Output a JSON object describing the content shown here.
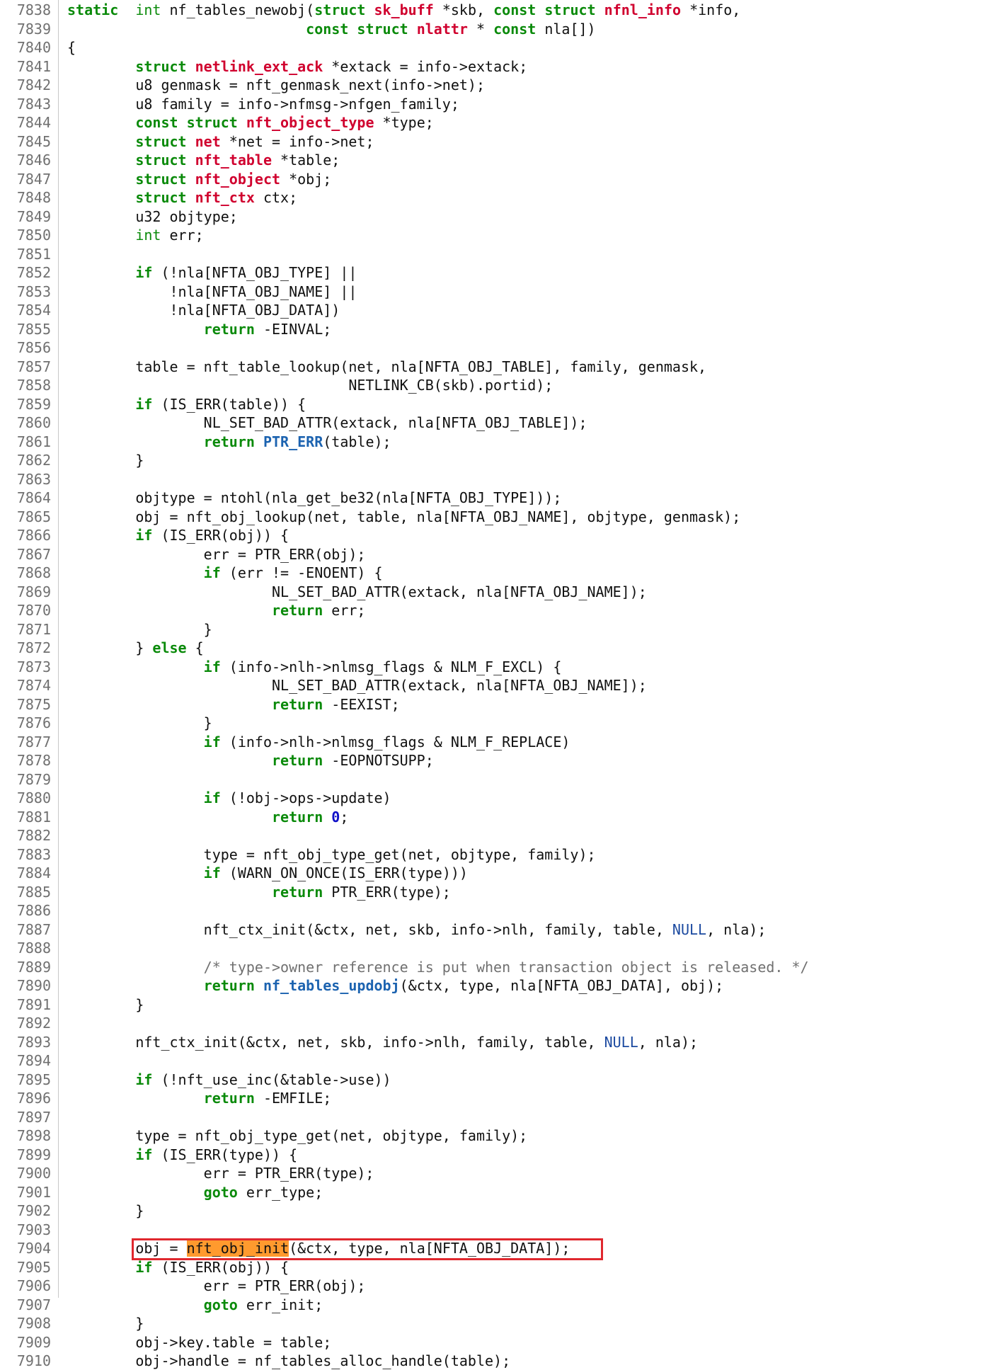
{
  "colors": {
    "keyword": "#0a8a0a",
    "struct_name": "#d0002e",
    "function_link": "#1c63b0",
    "number": "#1010c8",
    "constant": "#1c4aa0",
    "comment": "#707070",
    "line_number": "#707070",
    "highlight": "#ff9a2e",
    "annotation_box": "#e0282e"
  },
  "annotation": {
    "line_number": "7904",
    "highlighted_token": "nft_obj_init"
  },
  "lines": [
    {
      "n": "7838",
      "t": [
        [
          "kw",
          "static"
        ],
        [
          "",
          "  "
        ],
        [
          "ty",
          "int"
        ],
        [
          "",
          " nf_tables_newobj("
        ],
        [
          "kw",
          "struct"
        ],
        [
          "",
          " "
        ],
        [
          "st",
          "sk_buff"
        ],
        [
          "",
          " *skb, "
        ],
        [
          "kw",
          "const"
        ],
        [
          "",
          " "
        ],
        [
          "kw",
          "struct"
        ],
        [
          "",
          " "
        ],
        [
          "st",
          "nfnl_info"
        ],
        [
          "",
          " *info,"
        ]
      ]
    },
    {
      "n": "7839",
      "t": [
        [
          "",
          "                            "
        ],
        [
          "kw",
          "const"
        ],
        [
          "",
          " "
        ],
        [
          "kw",
          "struct"
        ],
        [
          "",
          " "
        ],
        [
          "st",
          "nlattr"
        ],
        [
          "",
          " * "
        ],
        [
          "kw",
          "const"
        ],
        [
          "",
          " nla[])"
        ]
      ]
    },
    {
      "n": "7840",
      "t": [
        [
          "",
          "{"
        ]
      ]
    },
    {
      "n": "7841",
      "t": [
        [
          "",
          "        "
        ],
        [
          "kw",
          "struct"
        ],
        [
          "",
          " "
        ],
        [
          "st",
          "netlink_ext_ack"
        ],
        [
          "",
          " *extack = info->extack;"
        ]
      ]
    },
    {
      "n": "7842",
      "t": [
        [
          "",
          "        u8 genmask = nft_genmask_next(info->net);"
        ]
      ]
    },
    {
      "n": "7843",
      "t": [
        [
          "",
          "        u8 family = info->nfmsg->nfgen_family;"
        ]
      ]
    },
    {
      "n": "7844",
      "t": [
        [
          "",
          "        "
        ],
        [
          "kw",
          "const"
        ],
        [
          "",
          " "
        ],
        [
          "kw",
          "struct"
        ],
        [
          "",
          " "
        ],
        [
          "st",
          "nft_object_type"
        ],
        [
          "",
          " *type;"
        ]
      ]
    },
    {
      "n": "7845",
      "t": [
        [
          "",
          "        "
        ],
        [
          "kw",
          "struct"
        ],
        [
          "",
          " "
        ],
        [
          "st",
          "net"
        ],
        [
          "",
          " *net = info->net;"
        ]
      ]
    },
    {
      "n": "7846",
      "t": [
        [
          "",
          "        "
        ],
        [
          "kw",
          "struct"
        ],
        [
          "",
          " "
        ],
        [
          "st",
          "nft_table"
        ],
        [
          "",
          " *table;"
        ]
      ]
    },
    {
      "n": "7847",
      "t": [
        [
          "",
          "        "
        ],
        [
          "kw",
          "struct"
        ],
        [
          "",
          " "
        ],
        [
          "st",
          "nft_object"
        ],
        [
          "",
          " *obj;"
        ]
      ]
    },
    {
      "n": "7848",
      "t": [
        [
          "",
          "        "
        ],
        [
          "kw",
          "struct"
        ],
        [
          "",
          " "
        ],
        [
          "st",
          "nft_ctx"
        ],
        [
          "",
          " ctx;"
        ]
      ]
    },
    {
      "n": "7849",
      "t": [
        [
          "",
          "        u32 objtype;"
        ]
      ]
    },
    {
      "n": "7850",
      "t": [
        [
          "",
          "        "
        ],
        [
          "ty",
          "int"
        ],
        [
          "",
          " err;"
        ]
      ]
    },
    {
      "n": "7851",
      "t": []
    },
    {
      "n": "7852",
      "t": [
        [
          "",
          "        "
        ],
        [
          "kw",
          "if"
        ],
        [
          "",
          " (!nla[NFTA_OBJ_TYPE] ||"
        ]
      ]
    },
    {
      "n": "7853",
      "t": [
        [
          "",
          "            !nla[NFTA_OBJ_NAME] ||"
        ]
      ]
    },
    {
      "n": "7854",
      "t": [
        [
          "",
          "            !nla[NFTA_OBJ_DATA])"
        ]
      ]
    },
    {
      "n": "7855",
      "t": [
        [
          "",
          "                "
        ],
        [
          "kw",
          "return"
        ],
        [
          "",
          " -EINVAL;"
        ]
      ]
    },
    {
      "n": "7856",
      "t": []
    },
    {
      "n": "7857",
      "t": [
        [
          "",
          "        table = nft_table_lookup(net, nla[NFTA_OBJ_TABLE], family, genmask,"
        ]
      ]
    },
    {
      "n": "7858",
      "t": [
        [
          "",
          "                                 NETLINK_CB(skb).portid);"
        ]
      ]
    },
    {
      "n": "7859",
      "t": [
        [
          "",
          "        "
        ],
        [
          "kw",
          "if"
        ],
        [
          "",
          " (IS_ERR(table)) {"
        ]
      ]
    },
    {
      "n": "7860",
      "t": [
        [
          "",
          "                NL_SET_BAD_ATTR(extack, nla[NFTA_OBJ_TABLE]);"
        ]
      ]
    },
    {
      "n": "7861",
      "t": [
        [
          "",
          "                "
        ],
        [
          "kw",
          "return"
        ],
        [
          "",
          " "
        ],
        [
          "fn",
          "PTR_ERR"
        ],
        [
          "",
          "(table);"
        ]
      ]
    },
    {
      "n": "7862",
      "t": [
        [
          "",
          "        }"
        ]
      ]
    },
    {
      "n": "7863",
      "t": []
    },
    {
      "n": "7864",
      "t": [
        [
          "",
          "        objtype = ntohl(nla_get_be32(nla[NFTA_OBJ_TYPE]));"
        ]
      ]
    },
    {
      "n": "7865",
      "t": [
        [
          "",
          "        obj = nft_obj_lookup(net, table, nla[NFTA_OBJ_NAME], objtype, genmask);"
        ]
      ]
    },
    {
      "n": "7866",
      "t": [
        [
          "",
          "        "
        ],
        [
          "kw",
          "if"
        ],
        [
          "",
          " (IS_ERR(obj)) {"
        ]
      ]
    },
    {
      "n": "7867",
      "t": [
        [
          "",
          "                err = PTR_ERR(obj);"
        ]
      ]
    },
    {
      "n": "7868",
      "t": [
        [
          "",
          "                "
        ],
        [
          "kw",
          "if"
        ],
        [
          "",
          " (err != -ENOENT) {"
        ]
      ]
    },
    {
      "n": "7869",
      "t": [
        [
          "",
          "                        NL_SET_BAD_ATTR(extack, nla[NFTA_OBJ_NAME]);"
        ]
      ]
    },
    {
      "n": "7870",
      "t": [
        [
          "",
          "                        "
        ],
        [
          "kw",
          "return"
        ],
        [
          "",
          " err;"
        ]
      ]
    },
    {
      "n": "7871",
      "t": [
        [
          "",
          "                }"
        ]
      ]
    },
    {
      "n": "7872",
      "t": [
        [
          "",
          "        } "
        ],
        [
          "kw",
          "else"
        ],
        [
          "",
          " {"
        ]
      ]
    },
    {
      "n": "7873",
      "t": [
        [
          "",
          "                "
        ],
        [
          "kw",
          "if"
        ],
        [
          "",
          " (info->nlh->nlmsg_flags & NLM_F_EXCL) {"
        ]
      ]
    },
    {
      "n": "7874",
      "t": [
        [
          "",
          "                        NL_SET_BAD_ATTR(extack, nla[NFTA_OBJ_NAME]);"
        ]
      ]
    },
    {
      "n": "7875",
      "t": [
        [
          "",
          "                        "
        ],
        [
          "kw",
          "return"
        ],
        [
          "",
          " -EEXIST;"
        ]
      ]
    },
    {
      "n": "7876",
      "t": [
        [
          "",
          "                }"
        ]
      ]
    },
    {
      "n": "7877",
      "t": [
        [
          "",
          "                "
        ],
        [
          "kw",
          "if"
        ],
        [
          "",
          " (info->nlh->nlmsg_flags & NLM_F_REPLACE)"
        ]
      ]
    },
    {
      "n": "7878",
      "t": [
        [
          "",
          "                        "
        ],
        [
          "kw",
          "return"
        ],
        [
          "",
          " -EOPNOTSUPP;"
        ]
      ]
    },
    {
      "n": "7879",
      "t": []
    },
    {
      "n": "7880",
      "t": [
        [
          "",
          "                "
        ],
        [
          "kw",
          "if"
        ],
        [
          "",
          " (!obj->ops->update)"
        ]
      ]
    },
    {
      "n": "7881",
      "t": [
        [
          "",
          "                        "
        ],
        [
          "kw",
          "return"
        ],
        [
          "",
          " "
        ],
        [
          "nu",
          "0"
        ],
        [
          "",
          ";"
        ]
      ]
    },
    {
      "n": "7882",
      "t": []
    },
    {
      "n": "7883",
      "t": [
        [
          "",
          "                type = nft_obj_type_get(net, objtype, family);"
        ]
      ]
    },
    {
      "n": "7884",
      "t": [
        [
          "",
          "                "
        ],
        [
          "kw",
          "if"
        ],
        [
          "",
          " (WARN_ON_ONCE(IS_ERR(type)))"
        ]
      ]
    },
    {
      "n": "7885",
      "t": [
        [
          "",
          "                        "
        ],
        [
          "kw",
          "return"
        ],
        [
          "",
          " PTR_ERR(type);"
        ]
      ]
    },
    {
      "n": "7886",
      "t": []
    },
    {
      "n": "7887",
      "t": [
        [
          "",
          "                nft_ctx_init(&ctx, net, skb, info->nlh, family, table, "
        ],
        [
          "cn",
          "NULL"
        ],
        [
          "",
          ", nla);"
        ]
      ]
    },
    {
      "n": "7888",
      "t": []
    },
    {
      "n": "7889",
      "t": [
        [
          "",
          "                "
        ],
        [
          "cm",
          "/* type->owner reference is put when transaction object is released. */"
        ]
      ]
    },
    {
      "n": "7890",
      "t": [
        [
          "",
          "                "
        ],
        [
          "kw",
          "return"
        ],
        [
          "",
          " "
        ],
        [
          "fn",
          "nf_tables_updobj"
        ],
        [
          "",
          "(&ctx, type, nla[NFTA_OBJ_DATA], obj);"
        ]
      ]
    },
    {
      "n": "7891",
      "t": [
        [
          "",
          "        }"
        ]
      ]
    },
    {
      "n": "7892",
      "t": []
    },
    {
      "n": "7893",
      "t": [
        [
          "",
          "        nft_ctx_init(&ctx, net, skb, info->nlh, family, table, "
        ],
        [
          "cn",
          "NULL"
        ],
        [
          "",
          ", nla);"
        ]
      ]
    },
    {
      "n": "7894",
      "t": []
    },
    {
      "n": "7895",
      "t": [
        [
          "",
          "        "
        ],
        [
          "kw",
          "if"
        ],
        [
          "",
          " (!nft_use_inc(&table->use))"
        ]
      ]
    },
    {
      "n": "7896",
      "t": [
        [
          "",
          "                "
        ],
        [
          "kw",
          "return"
        ],
        [
          "",
          " -EMFILE;"
        ]
      ]
    },
    {
      "n": "7897",
      "t": []
    },
    {
      "n": "7898",
      "t": [
        [
          "",
          "        type = nft_obj_type_get(net, objtype, family);"
        ]
      ]
    },
    {
      "n": "7899",
      "t": [
        [
          "",
          "        "
        ],
        [
          "kw",
          "if"
        ],
        [
          "",
          " (IS_ERR(type)) {"
        ]
      ]
    },
    {
      "n": "7900",
      "t": [
        [
          "",
          "                err = PTR_ERR(type);"
        ]
      ]
    },
    {
      "n": "7901",
      "t": [
        [
          "",
          "                "
        ],
        [
          "kw",
          "goto"
        ],
        [
          "",
          " err_type;"
        ]
      ]
    },
    {
      "n": "7902",
      "t": [
        [
          "",
          "        }"
        ]
      ]
    },
    {
      "n": "7903",
      "t": []
    },
    {
      "n": "7904",
      "t": [
        [
          "",
          "        obj = "
        ],
        [
          "hl",
          "nft_obj_init"
        ],
        [
          "",
          "(&ctx, type, nla[NFTA_OBJ_DATA]);"
        ]
      ]
    },
    {
      "n": "7905",
      "t": [
        [
          "",
          "        "
        ],
        [
          "kw",
          "if"
        ],
        [
          "",
          " (IS_ERR(obj)) {"
        ]
      ]
    },
    {
      "n": "7906",
      "t": [
        [
          "",
          "                err = PTR_ERR(obj);"
        ]
      ]
    },
    {
      "n": "7907",
      "t": [
        [
          "",
          "                "
        ],
        [
          "kw",
          "goto"
        ],
        [
          "",
          " err_init;"
        ]
      ]
    },
    {
      "n": "7908",
      "t": [
        [
          "",
          "        }"
        ]
      ]
    },
    {
      "n": "7909",
      "t": [
        [
          "",
          "        obj->key.table = table;"
        ]
      ]
    },
    {
      "n": "7910",
      "t": [
        [
          "",
          "        obj->handle = nf_tables_alloc_handle(table);"
        ]
      ]
    }
  ]
}
